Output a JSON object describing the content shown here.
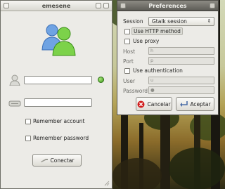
{
  "emesene": {
    "title": "emesene",
    "remember_account": "Remember account",
    "remember_password": "Remember password",
    "connect_button": "Conectar"
  },
  "preferences": {
    "title": "Preferences",
    "session_label": "Session",
    "session_value": "Gtalk session",
    "use_http_method": "Use HTTP method",
    "use_proxy": "Use proxy",
    "host_label": "Host",
    "host_value": "h",
    "port_label": "Port",
    "port_value": "p",
    "use_authentication": "Use authentication",
    "user_label": "User",
    "user_value": "u",
    "password_label": "Password",
    "password_value": "●",
    "cancel_button": "Cancelar",
    "accept_button": "Aceptar"
  },
  "colors": {
    "status_online": "#3f9b1e",
    "cancel_icon": "#d01c1c"
  }
}
